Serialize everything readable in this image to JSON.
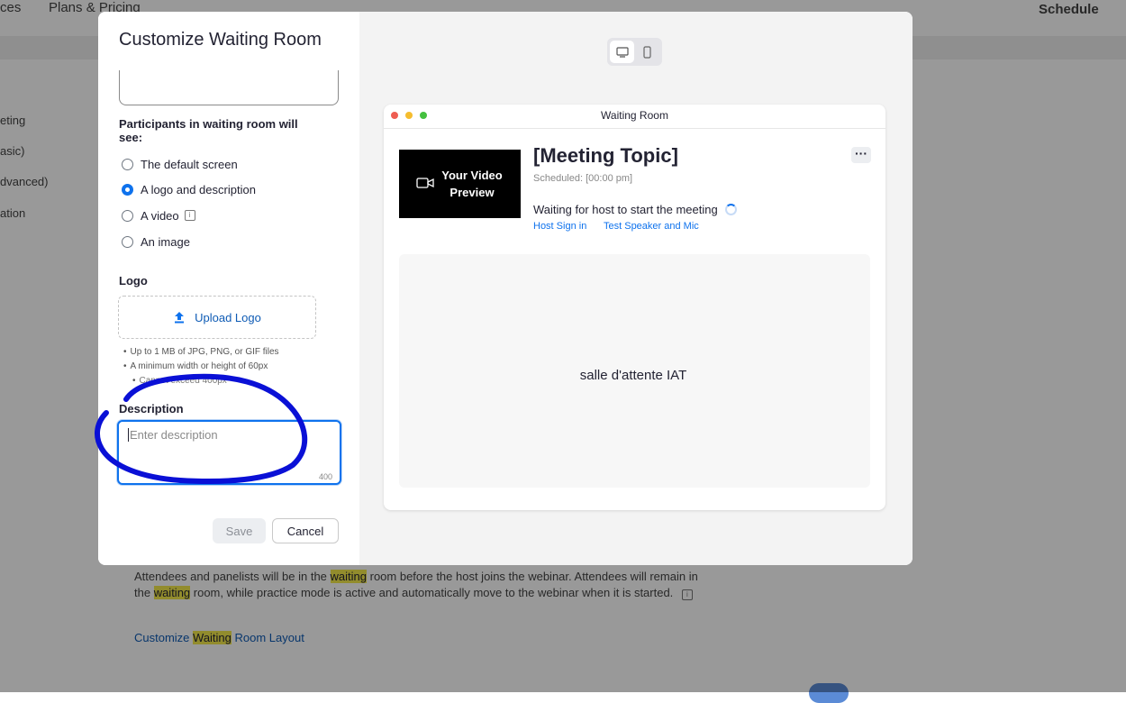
{
  "background": {
    "nav": {
      "left_item": "ces",
      "plans_pricing": "Plans & Pricing",
      "schedule": "Schedule"
    },
    "side_items": [
      "eting",
      "asic)",
      "dvanced)",
      "ation"
    ],
    "description": {
      "part1": "Attendees and panelists will be in the ",
      "hl1": "waiting",
      "part2": " room before the host joins the webinar. Attendees will remain in the ",
      "hl2": "waiting",
      "part3": " room, while practice mode is active and automatically move to the webinar when it is started."
    },
    "link": {
      "before": "Customize ",
      "highlight": "Waiting",
      "after": " Room Layout"
    }
  },
  "modal": {
    "title": "Customize Waiting Room",
    "participants_label": "Participants in waiting room will see:",
    "options": [
      {
        "label": "The default screen",
        "checked": false
      },
      {
        "label": "A logo and description",
        "checked": true
      },
      {
        "label": "A video",
        "checked": false
      },
      {
        "label": "An image",
        "checked": false
      }
    ],
    "logo_label": "Logo",
    "upload_label": "Upload Logo",
    "notes": [
      "Up to 1 MB of JPG, PNG, or GIF files",
      "A minimum width or height of 60px"
    ],
    "notes_occluded": "Cannot exceed 400px",
    "description_label": "Description",
    "description_placeholder": "Enter description",
    "counter": "400",
    "save_label": "Save",
    "cancel_label": "Cancel"
  },
  "preview": {
    "window_title": "Waiting Room",
    "video_text": "Your Video Preview",
    "meeting_topic": "[Meeting Topic]",
    "scheduled": "Scheduled: [00:00 pm]",
    "waiting_text": "Waiting for host to start the meeting",
    "host_sign_in": "Host Sign in",
    "test_speaker": "Test Speaker and Mic",
    "more": "···",
    "content_text": "salle d'attente IAT"
  },
  "colors": {
    "accent": "#0e72ed",
    "link": "#0e5bb5",
    "annotation": "#0a10d6",
    "highlight": "#f4e94c",
    "dot_red": "#ee5d52",
    "dot_yellow": "#f5bd2f",
    "dot_green": "#44c03f"
  },
  "icons": [
    "desktop-icon",
    "mobile-icon",
    "upload-icon",
    "video-camera-icon",
    "info-icon",
    "loading-spinner-icon",
    "more-icon"
  ]
}
